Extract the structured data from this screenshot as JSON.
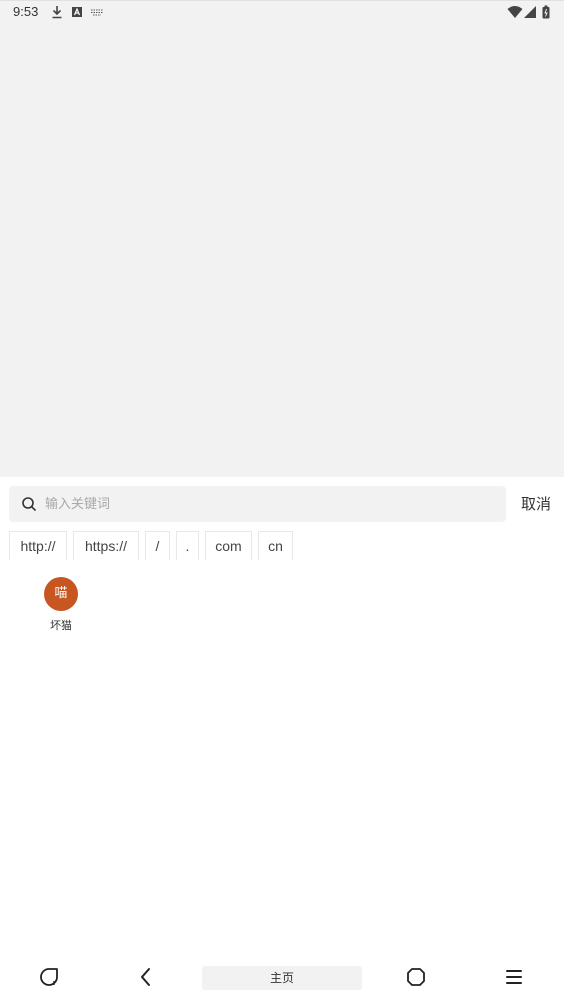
{
  "status_bar": {
    "time": "9:53",
    "icons": [
      "download-icon",
      "a-badge-icon",
      "keyboard-icon",
      "wifi-icon",
      "signal-icon",
      "battery-icon"
    ]
  },
  "search": {
    "placeholder": "输入关键词",
    "value": "",
    "cancel_label": "取消"
  },
  "quick_inputs": [
    "http://",
    "https://",
    "/",
    ".",
    "com",
    "cn"
  ],
  "bookmarks": [
    {
      "avatar_text": "喵",
      "label": "坏猫",
      "color": "#c75620"
    }
  ],
  "bottom_bar": {
    "home_label": "主页",
    "icons": [
      "tabs-icon",
      "back-icon",
      "home-icon",
      "menu-icon"
    ]
  }
}
